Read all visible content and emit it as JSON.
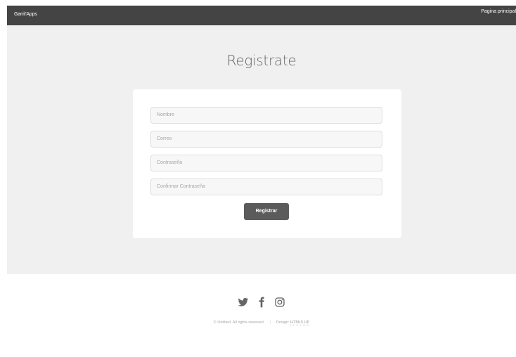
{
  "header": {
    "brand": "Garrit'Apps",
    "nav_link": "Pagina principal"
  },
  "main": {
    "title": "Registrate",
    "form": {
      "fields": [
        {
          "placeholder": "Nombre",
          "value": ""
        },
        {
          "placeholder": "Correo",
          "value": ""
        },
        {
          "placeholder": "Contraseña",
          "value": ""
        },
        {
          "placeholder": "Confirmar Contraseña",
          "value": ""
        }
      ],
      "submit_label": "Registrar"
    }
  },
  "footer": {
    "social_icons": [
      "twitter-icon",
      "facebook-icon",
      "instagram-icon"
    ],
    "copyright": "© Untitled. All rights reserved.",
    "separator": "|",
    "design_prefix": "Design:",
    "design_link": "HTML5 UP"
  },
  "colors": {
    "header_bg": "#444444",
    "main_bg": "#f0f0f0",
    "button_bg": "#5b5b5b",
    "icon_color": "#666666"
  }
}
